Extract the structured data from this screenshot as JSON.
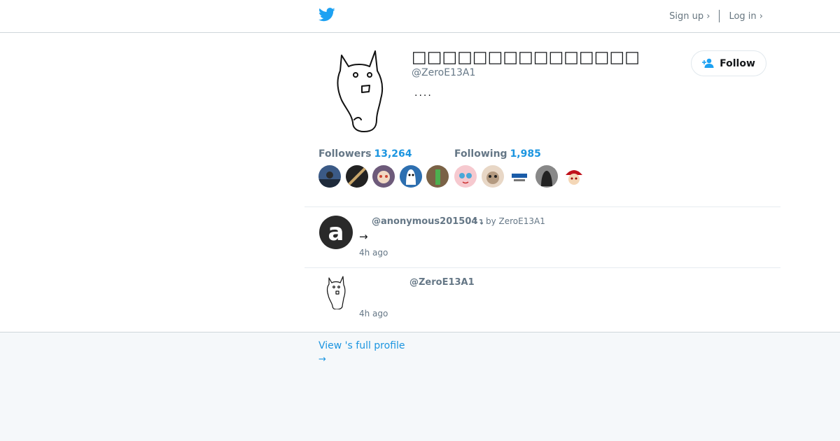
{
  "header": {
    "brand_icon": "twitter-bird-icon",
    "brand_color": "#1da1f2",
    "signup_label": "Sign up ›",
    "login_label": "Log in ›"
  },
  "profile": {
    "display_name": "□□□□□□□□□□□□□□□",
    "handle": "@ZeroE13A1",
    "bio": "....",
    "follow_label": "Follow",
    "followers_label": "Followers",
    "followers_count": "13,264",
    "following_label": "Following",
    "following_count": "1,985",
    "accent_color": "#1b95e0"
  },
  "tweets": [
    {
      "handle": "@anonymous201504",
      "retweet_label": "by ZeroE13A1",
      "text": "→",
      "time": "4h ago"
    },
    {
      "handle": "@ZeroE13A1",
      "text": "",
      "time": "4h ago"
    }
  ],
  "footer": {
    "full_profile_label": "View 's full profile",
    "arrow": "→"
  }
}
